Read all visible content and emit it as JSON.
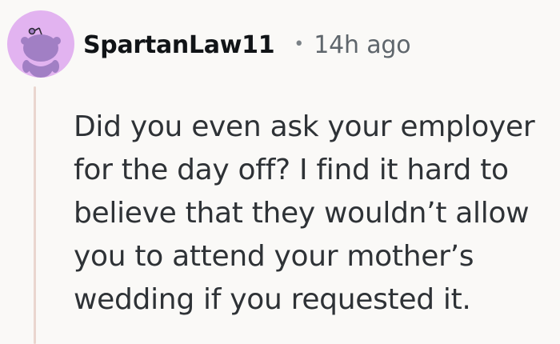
{
  "comment": {
    "author": "SpartanLaw11",
    "separator": "•",
    "timestamp": "14h ago",
    "body": "Did you even ask your employer for the day off? I find it hard to believe that they wouldn’t allow you to attend your mother’s wedding if you requested it.",
    "avatar_icon": "snoo-avatar-icon",
    "colors": {
      "avatar_background": "#e2b3f0",
      "avatar_figure": "#a17fc4",
      "thread_line": "#ead6cf",
      "page_background": "#faf9f7"
    }
  }
}
